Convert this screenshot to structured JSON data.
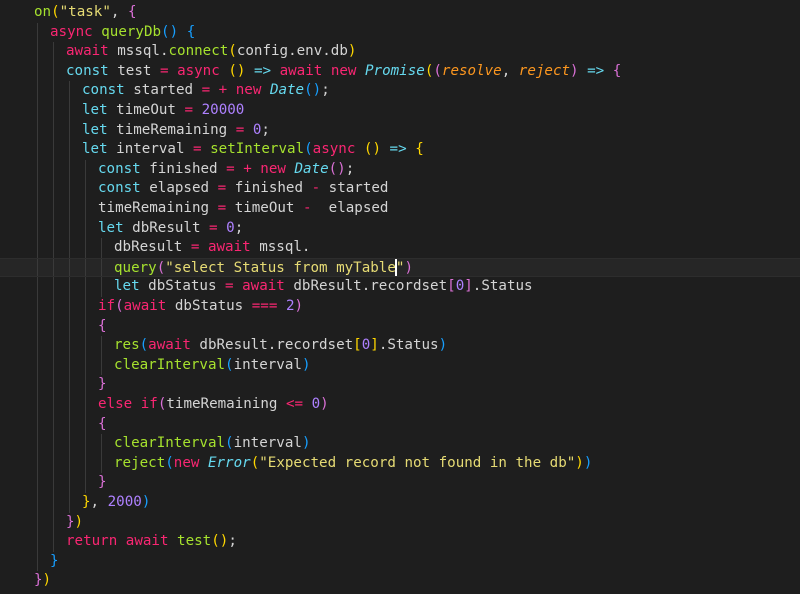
{
  "colors": {
    "background": "#1e1e1e",
    "plain": "#d4d4d4",
    "keyword": "#f92672",
    "storage": "#66d9ef",
    "function": "#a6e22e",
    "string": "#e6db74",
    "number": "#ae81ff",
    "parameter": "#fd971f",
    "class": "#66d9ef",
    "bracket_gold": "#ffd700",
    "bracket_pink": "#da70d6",
    "bracket_blue": "#179fff"
  },
  "editor": {
    "cursor_line": 13,
    "lines": [
      {
        "indent": 2,
        "tokens": [
          [
            "on",
            "function"
          ],
          [
            "(",
            "bracket_gold"
          ],
          [
            "\"task\"",
            "string"
          ],
          [
            ", ",
            "plain"
          ],
          [
            "{",
            "bracket_pink"
          ]
        ]
      },
      {
        "indent": 3,
        "tokens": [
          [
            "async ",
            "keyword"
          ],
          [
            "queryDb",
            "function"
          ],
          [
            "()",
            "bracket_blue"
          ],
          [
            " ",
            "plain"
          ],
          [
            "{",
            "bracket_blue"
          ]
        ]
      },
      {
        "indent": 4,
        "tokens": [
          [
            "await ",
            "keyword"
          ],
          [
            "mssql.",
            "plain"
          ],
          [
            "connect",
            "function"
          ],
          [
            "(",
            "bracket_gold"
          ],
          [
            "config.env.db",
            "plain"
          ],
          [
            ")",
            "bracket_gold"
          ]
        ]
      },
      {
        "indent": 4,
        "tokens": [
          [
            "const ",
            "storage"
          ],
          [
            "test ",
            "plain"
          ],
          [
            "= ",
            "keyword"
          ],
          [
            "async ",
            "keyword"
          ],
          [
            "()",
            "bracket_gold"
          ],
          [
            " ",
            "plain"
          ],
          [
            "=>",
            "storage"
          ],
          [
            " ",
            "plain"
          ],
          [
            "await ",
            "keyword"
          ],
          [
            "new ",
            "keyword"
          ],
          [
            "Promise",
            "class"
          ],
          [
            "(",
            "bracket_gold"
          ],
          [
            "(",
            "bracket_pink"
          ],
          [
            "resolve",
            "parameter"
          ],
          [
            ", ",
            "plain"
          ],
          [
            "reject",
            "parameter"
          ],
          [
            ")",
            "bracket_pink"
          ],
          [
            " ",
            "plain"
          ],
          [
            "=>",
            "storage"
          ],
          [
            " ",
            "plain"
          ],
          [
            "{",
            "bracket_pink"
          ]
        ]
      },
      {
        "indent": 5,
        "tokens": [
          [
            "const ",
            "storage"
          ],
          [
            "started ",
            "plain"
          ],
          [
            "= + ",
            "keyword"
          ],
          [
            "new ",
            "keyword"
          ],
          [
            "Date",
            "class"
          ],
          [
            "()",
            "bracket_blue"
          ],
          [
            ";",
            "plain"
          ]
        ]
      },
      {
        "indent": 5,
        "tokens": [
          [
            "let ",
            "storage"
          ],
          [
            "timeOut ",
            "plain"
          ],
          [
            "= ",
            "keyword"
          ],
          [
            "20000",
            "number"
          ]
        ]
      },
      {
        "indent": 5,
        "tokens": [
          [
            "let ",
            "storage"
          ],
          [
            "timeRemaining ",
            "plain"
          ],
          [
            "= ",
            "keyword"
          ],
          [
            "0",
            "number"
          ],
          [
            ";",
            "plain"
          ]
        ]
      },
      {
        "indent": 5,
        "tokens": [
          [
            "let ",
            "storage"
          ],
          [
            "interval ",
            "plain"
          ],
          [
            "= ",
            "keyword"
          ],
          [
            "setInterval",
            "function"
          ],
          [
            "(",
            "bracket_blue"
          ],
          [
            "async ",
            "keyword"
          ],
          [
            "()",
            "bracket_gold"
          ],
          [
            " ",
            "plain"
          ],
          [
            "=>",
            "storage"
          ],
          [
            " ",
            "plain"
          ],
          [
            "{",
            "bracket_gold"
          ]
        ]
      },
      {
        "indent": 6,
        "tokens": [
          [
            "const ",
            "storage"
          ],
          [
            "finished ",
            "plain"
          ],
          [
            "= + ",
            "keyword"
          ],
          [
            "new ",
            "keyword"
          ],
          [
            "Date",
            "class"
          ],
          [
            "()",
            "bracket_pink"
          ],
          [
            ";",
            "plain"
          ]
        ]
      },
      {
        "indent": 6,
        "tokens": [
          [
            "const ",
            "storage"
          ],
          [
            "elapsed ",
            "plain"
          ],
          [
            "= ",
            "keyword"
          ],
          [
            "finished ",
            "plain"
          ],
          [
            "- ",
            "keyword"
          ],
          [
            "started",
            "plain"
          ]
        ]
      },
      {
        "indent": 6,
        "tokens": [
          [
            "timeRemaining ",
            "plain"
          ],
          [
            "= ",
            "keyword"
          ],
          [
            "timeOut ",
            "plain"
          ],
          [
            "-  ",
            "keyword"
          ],
          [
            "elapsed",
            "plain"
          ]
        ]
      },
      {
        "indent": 6,
        "tokens": [
          [
            "let ",
            "storage"
          ],
          [
            "dbResult ",
            "plain"
          ],
          [
            "= ",
            "keyword"
          ],
          [
            "0",
            "number"
          ],
          [
            ";",
            "plain"
          ]
        ]
      },
      {
        "indent": 7,
        "tokens": [
          [
            "dbResult ",
            "plain"
          ],
          [
            "= ",
            "keyword"
          ],
          [
            "await ",
            "keyword"
          ],
          [
            "mssql.",
            "plain"
          ]
        ]
      },
      {
        "indent": 7,
        "tokens": [
          [
            "query",
            "function"
          ],
          [
            "(",
            "bracket_pink"
          ],
          [
            "\"select Status from myTable",
            "string"
          ],
          [
            "|",
            "caret"
          ],
          [
            "\"",
            "string"
          ],
          [
            ")",
            "bracket_pink"
          ]
        ]
      },
      {
        "indent": 7,
        "tokens": [
          [
            "let ",
            "storage"
          ],
          [
            "dbStatus ",
            "plain"
          ],
          [
            "= ",
            "keyword"
          ],
          [
            "await ",
            "keyword"
          ],
          [
            "dbResult.recordset",
            "plain"
          ],
          [
            "[",
            "bracket_pink"
          ],
          [
            "0",
            "number"
          ],
          [
            "]",
            "bracket_pink"
          ],
          [
            ".Status",
            "plain"
          ]
        ]
      },
      {
        "indent": 6,
        "tokens": [
          [
            "if",
            "keyword"
          ],
          [
            "(",
            "bracket_pink"
          ],
          [
            "await ",
            "keyword"
          ],
          [
            "dbStatus ",
            "plain"
          ],
          [
            "=== ",
            "keyword"
          ],
          [
            "2",
            "number"
          ],
          [
            ")",
            "bracket_pink"
          ]
        ]
      },
      {
        "indent": 6,
        "tokens": [
          [
            "{",
            "bracket_pink"
          ]
        ]
      },
      {
        "indent": 7,
        "tokens": [
          [
            "res",
            "function"
          ],
          [
            "(",
            "bracket_blue"
          ],
          [
            "await ",
            "keyword"
          ],
          [
            "dbResult.recordset",
            "plain"
          ],
          [
            "[",
            "bracket_gold"
          ],
          [
            "0",
            "number"
          ],
          [
            "]",
            "bracket_gold"
          ],
          [
            ".Status",
            "plain"
          ],
          [
            ")",
            "bracket_blue"
          ]
        ]
      },
      {
        "indent": 7,
        "tokens": [
          [
            "clearInterval",
            "function"
          ],
          [
            "(",
            "bracket_blue"
          ],
          [
            "interval",
            "plain"
          ],
          [
            ")",
            "bracket_blue"
          ]
        ]
      },
      {
        "indent": 6,
        "tokens": [
          [
            "}",
            "bracket_pink"
          ]
        ]
      },
      {
        "indent": 6,
        "tokens": [
          [
            "else ",
            "keyword"
          ],
          [
            "if",
            "keyword"
          ],
          [
            "(",
            "bracket_pink"
          ],
          [
            "timeRemaining ",
            "plain"
          ],
          [
            "<= ",
            "keyword"
          ],
          [
            "0",
            "number"
          ],
          [
            ")",
            "bracket_pink"
          ]
        ]
      },
      {
        "indent": 6,
        "tokens": [
          [
            "{",
            "bracket_pink"
          ]
        ]
      },
      {
        "indent": 7,
        "tokens": [
          [
            "clearInterval",
            "function"
          ],
          [
            "(",
            "bracket_blue"
          ],
          [
            "interval",
            "plain"
          ],
          [
            ")",
            "bracket_blue"
          ]
        ]
      },
      {
        "indent": 7,
        "tokens": [
          [
            "reject",
            "function"
          ],
          [
            "(",
            "bracket_blue"
          ],
          [
            "new ",
            "keyword"
          ],
          [
            "Error",
            "class"
          ],
          [
            "(",
            "bracket_gold"
          ],
          [
            "\"Expected record not found in the db\"",
            "string"
          ],
          [
            ")",
            "bracket_gold"
          ],
          [
            ")",
            "bracket_blue"
          ]
        ]
      },
      {
        "indent": 6,
        "tokens": [
          [
            "}",
            "bracket_pink"
          ]
        ]
      },
      {
        "indent": 5,
        "tokens": [
          [
            "}",
            "bracket_gold"
          ],
          [
            ", ",
            "plain"
          ],
          [
            "2000",
            "number"
          ],
          [
            ")",
            "bracket_blue"
          ]
        ]
      },
      {
        "indent": 4,
        "tokens": [
          [
            "}",
            "bracket_pink"
          ],
          [
            ")",
            "bracket_gold"
          ]
        ]
      },
      {
        "indent": 4,
        "tokens": [
          [
            "return ",
            "keyword"
          ],
          [
            "await ",
            "keyword"
          ],
          [
            "test",
            "function"
          ],
          [
            "()",
            "bracket_gold"
          ],
          [
            ";",
            "plain"
          ]
        ]
      },
      {
        "indent": 3,
        "tokens": [
          [
            "}",
            "bracket_blue"
          ]
        ]
      },
      {
        "indent": 2,
        "tokens": [
          [
            "}",
            "bracket_pink"
          ],
          [
            ")",
            "bracket_gold"
          ]
        ]
      }
    ]
  }
}
